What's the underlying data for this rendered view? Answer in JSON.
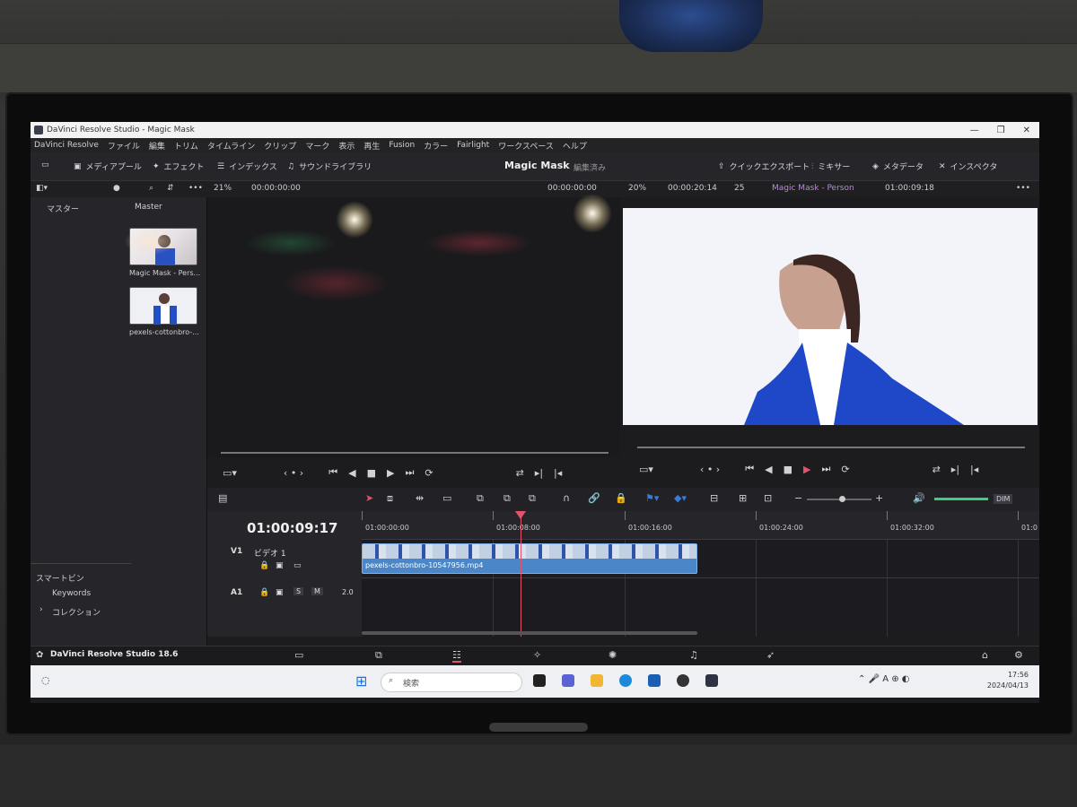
{
  "window": {
    "title": "DaVinci Resolve Studio - Magic Mask",
    "controls": [
      "—",
      "❐",
      "✕"
    ]
  },
  "menu": [
    "DaVinci Resolve",
    "ファイル",
    "編集",
    "トリム",
    "タイムライン",
    "クリップ",
    "マーク",
    "表示",
    "再生",
    "Fusion",
    "カラー",
    "Fairlight",
    "ワークスペース",
    "ヘルプ"
  ],
  "toolbar": {
    "media_pool": "メディアプール",
    "effects": "エフェクト",
    "index": "インデックス",
    "sound_library": "サウンドライブラリ",
    "project_title": "Magic Mask",
    "project_status": "編集済み",
    "quick_export": "クイックエクスポート",
    "mixer": "ミキサー",
    "metadata": "メタデータ",
    "inspector": "インスペクタ"
  },
  "subbar": {
    "zoom_left": "21%",
    "timecode_left": "00:00:00:00",
    "timecode_src": "00:00:00:00",
    "zoom_right": "20%",
    "duration": "00:00:20:14",
    "fps": "25",
    "timeline_name": "Magic Mask - Person",
    "timecode_right": "01:00:09:18"
  },
  "pool": {
    "header_master": "マスター",
    "header_bin": "Master",
    "clips": [
      "Magic Mask - Pers...",
      "pexels-cottonbro-..."
    ],
    "smart_bins": "スマートビン",
    "keywords": "Keywords",
    "collection": "コレクション"
  },
  "timeline": {
    "timecode": "01:00:09:17",
    "v1_label": "V1",
    "v1_name": "ビデオ 1",
    "a1_label": "A1",
    "a1_level": "2.0",
    "s_btn": "S",
    "m_btn": "M",
    "ruler": [
      "01:00:00:00",
      "01:00:08:00",
      "01:00:16:00",
      "01:00:24:00",
      "01:00:32:00",
      "01:0"
    ],
    "clip_name": "pexels-cottonbro-10547956.mp4",
    "dim": "DIM"
  },
  "pagebar": {
    "brand": "DaVinci Resolve Studio 18.6"
  },
  "taskbar": {
    "search_placeholder": "検索",
    "time": "17:56",
    "date": "2024/04/13"
  }
}
